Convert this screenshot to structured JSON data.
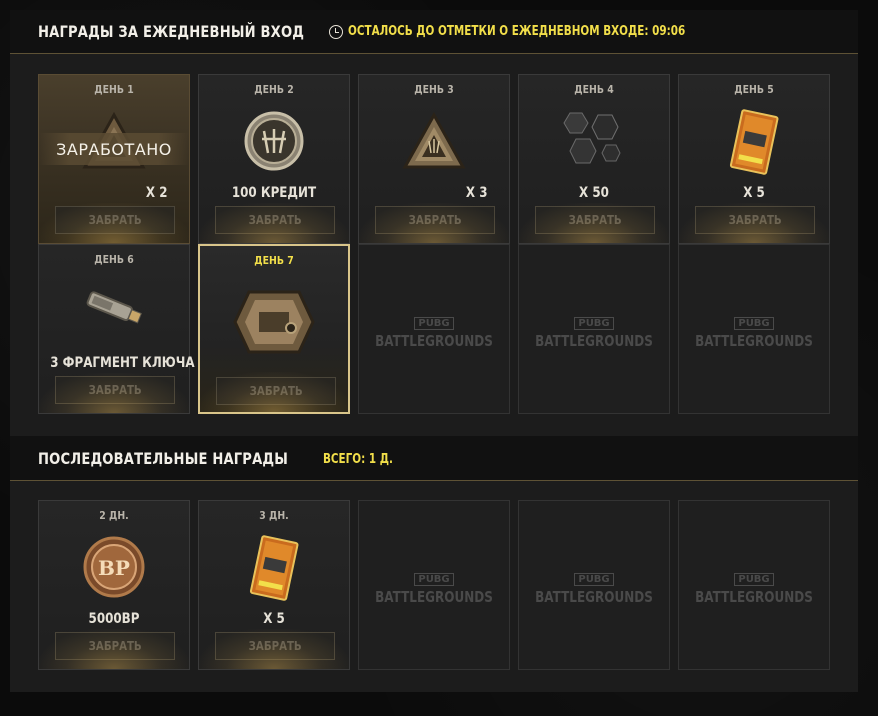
{
  "daily": {
    "title": "НАГРАДЫ ЗА ЕЖЕДНЕВНЫЙ ВХОД",
    "timer_text": "ОСТАЛОСЬ ДО ОТМЕТКИ О ЕЖЕДНЕВНОМ ВХОДЕ: 09:06",
    "earned_label": "ЗАРАБОТАНО",
    "claim_label": "ЗАБРАТЬ",
    "days": [
      {
        "label": "ДЕНЬ 1",
        "qty": "X 2",
        "state": "earned",
        "icon": "crate-icon"
      },
      {
        "label": "ДЕНЬ 2",
        "name": "100 КРЕДИТ",
        "state": "locked",
        "icon": "credit-coin-icon"
      },
      {
        "label": "ДЕНЬ 3",
        "qty": "X 3",
        "state": "locked",
        "icon": "crate-icon"
      },
      {
        "label": "ДЕНЬ 4",
        "name": "X 50",
        "state": "locked",
        "icon": "hexagon-tokens-icon"
      },
      {
        "label": "ДЕНЬ 5",
        "name": "X 5",
        "state": "locked",
        "icon": "ticket-card-icon"
      },
      {
        "label": "ДЕНЬ 6",
        "name": "3 ФРАГМЕНТ КЛЮЧА",
        "state": "locked",
        "icon": "key-fragment-icon"
      },
      {
        "label": "ДЕНЬ 7",
        "state": "today",
        "icon": "large-crate-icon"
      }
    ]
  },
  "streak": {
    "title": "ПОСЛЕДОВАТЕЛЬНЫЕ НАГРАДЫ",
    "total": "ВСЕГО: 1 Д.",
    "items": [
      {
        "label": "2 ДН.",
        "name": "5000BP",
        "icon": "bp-coin-icon",
        "coin_text": "BP"
      },
      {
        "label": "3 ДН.",
        "name": "X 5",
        "icon": "ticket-card-icon"
      }
    ]
  },
  "placeholder": {
    "pubg": "PUBG",
    "battlegrounds": "BATTLEGROUNDS"
  }
}
